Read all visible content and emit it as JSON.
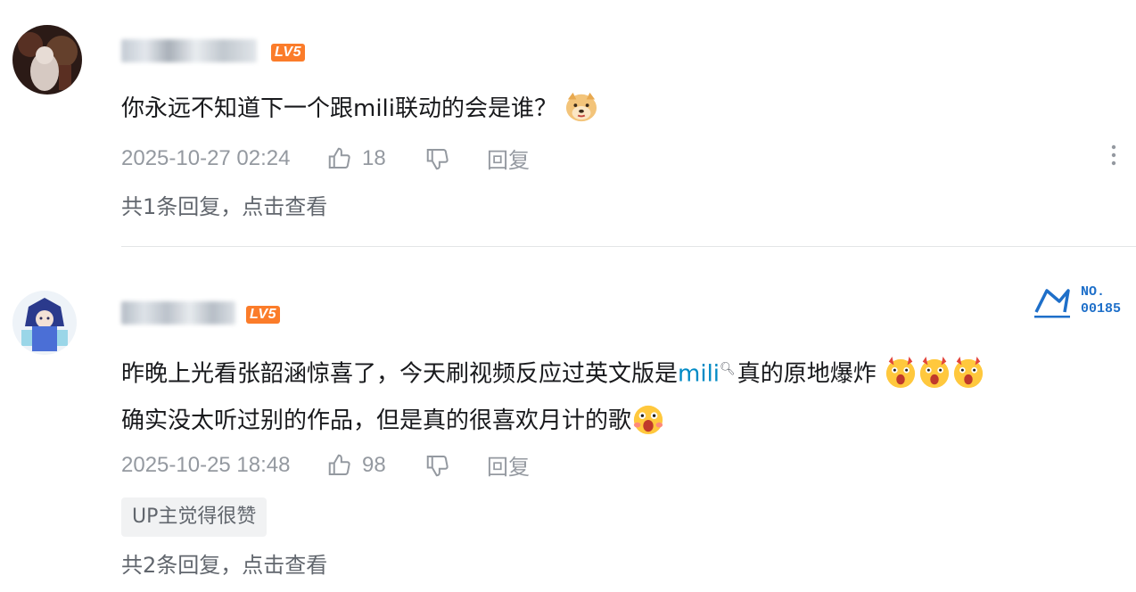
{
  "comments": [
    {
      "level": "LV5",
      "text_parts": [
        "你永远不知道下一个跟mili联动的会是谁？"
      ],
      "emoji": [
        "doge-emoji"
      ],
      "time": "2025-10-27 02:24",
      "likes": "18",
      "reply_label": "回复",
      "view_replies": "共1条回复，点击查看"
    },
    {
      "level": "LV5",
      "line1_before": "昨晚上光看张韶涵惊喜了，今天刷视频反应过英文版是",
      "keyword": "mili",
      "line1_after": "真的原地爆炸",
      "line2": "确实没太听过别的作品，但是真的很喜欢月计的歌",
      "time": "2025-10-25 18:48",
      "likes": "98",
      "reply_label": "回复",
      "up_badge": "UP主觉得很赞",
      "view_replies": "共2条回复，点击查看",
      "fan_badge": {
        "no_label": "NO.",
        "no_value": "00185"
      }
    }
  ],
  "colors": {
    "level_badge": "#fb7c2a",
    "keyword": "#008ac5",
    "meta": "#9499a0",
    "fan_badge": "#1e6fc9"
  }
}
